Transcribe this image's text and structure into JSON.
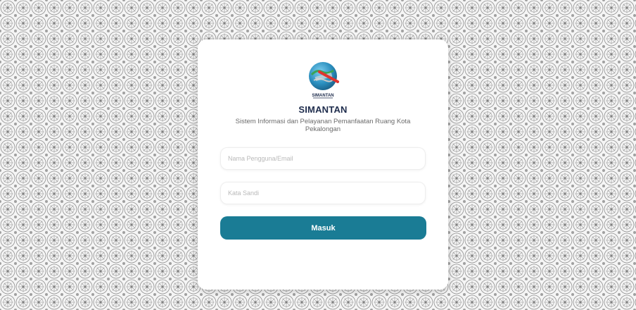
{
  "app": {
    "logo_text": "SIMANTAN",
    "title": "SIMANTAN",
    "subtitle": "Sistem Informasi dan Pelayanan Pemanfaatan Ruang Kota Pekalongan"
  },
  "form": {
    "username": {
      "value": "",
      "placeholder": "Nama Pengguna/Email"
    },
    "password": {
      "value": "",
      "placeholder": "Kata Sandi"
    },
    "submit_label": "Masuk"
  },
  "colors": {
    "primary": "#1a7c95",
    "title": "#1f2d4d",
    "background": "#f4f4f4",
    "pattern": "#8f8f8f"
  },
  "icons": {
    "logo": "globe-logo-icon"
  }
}
